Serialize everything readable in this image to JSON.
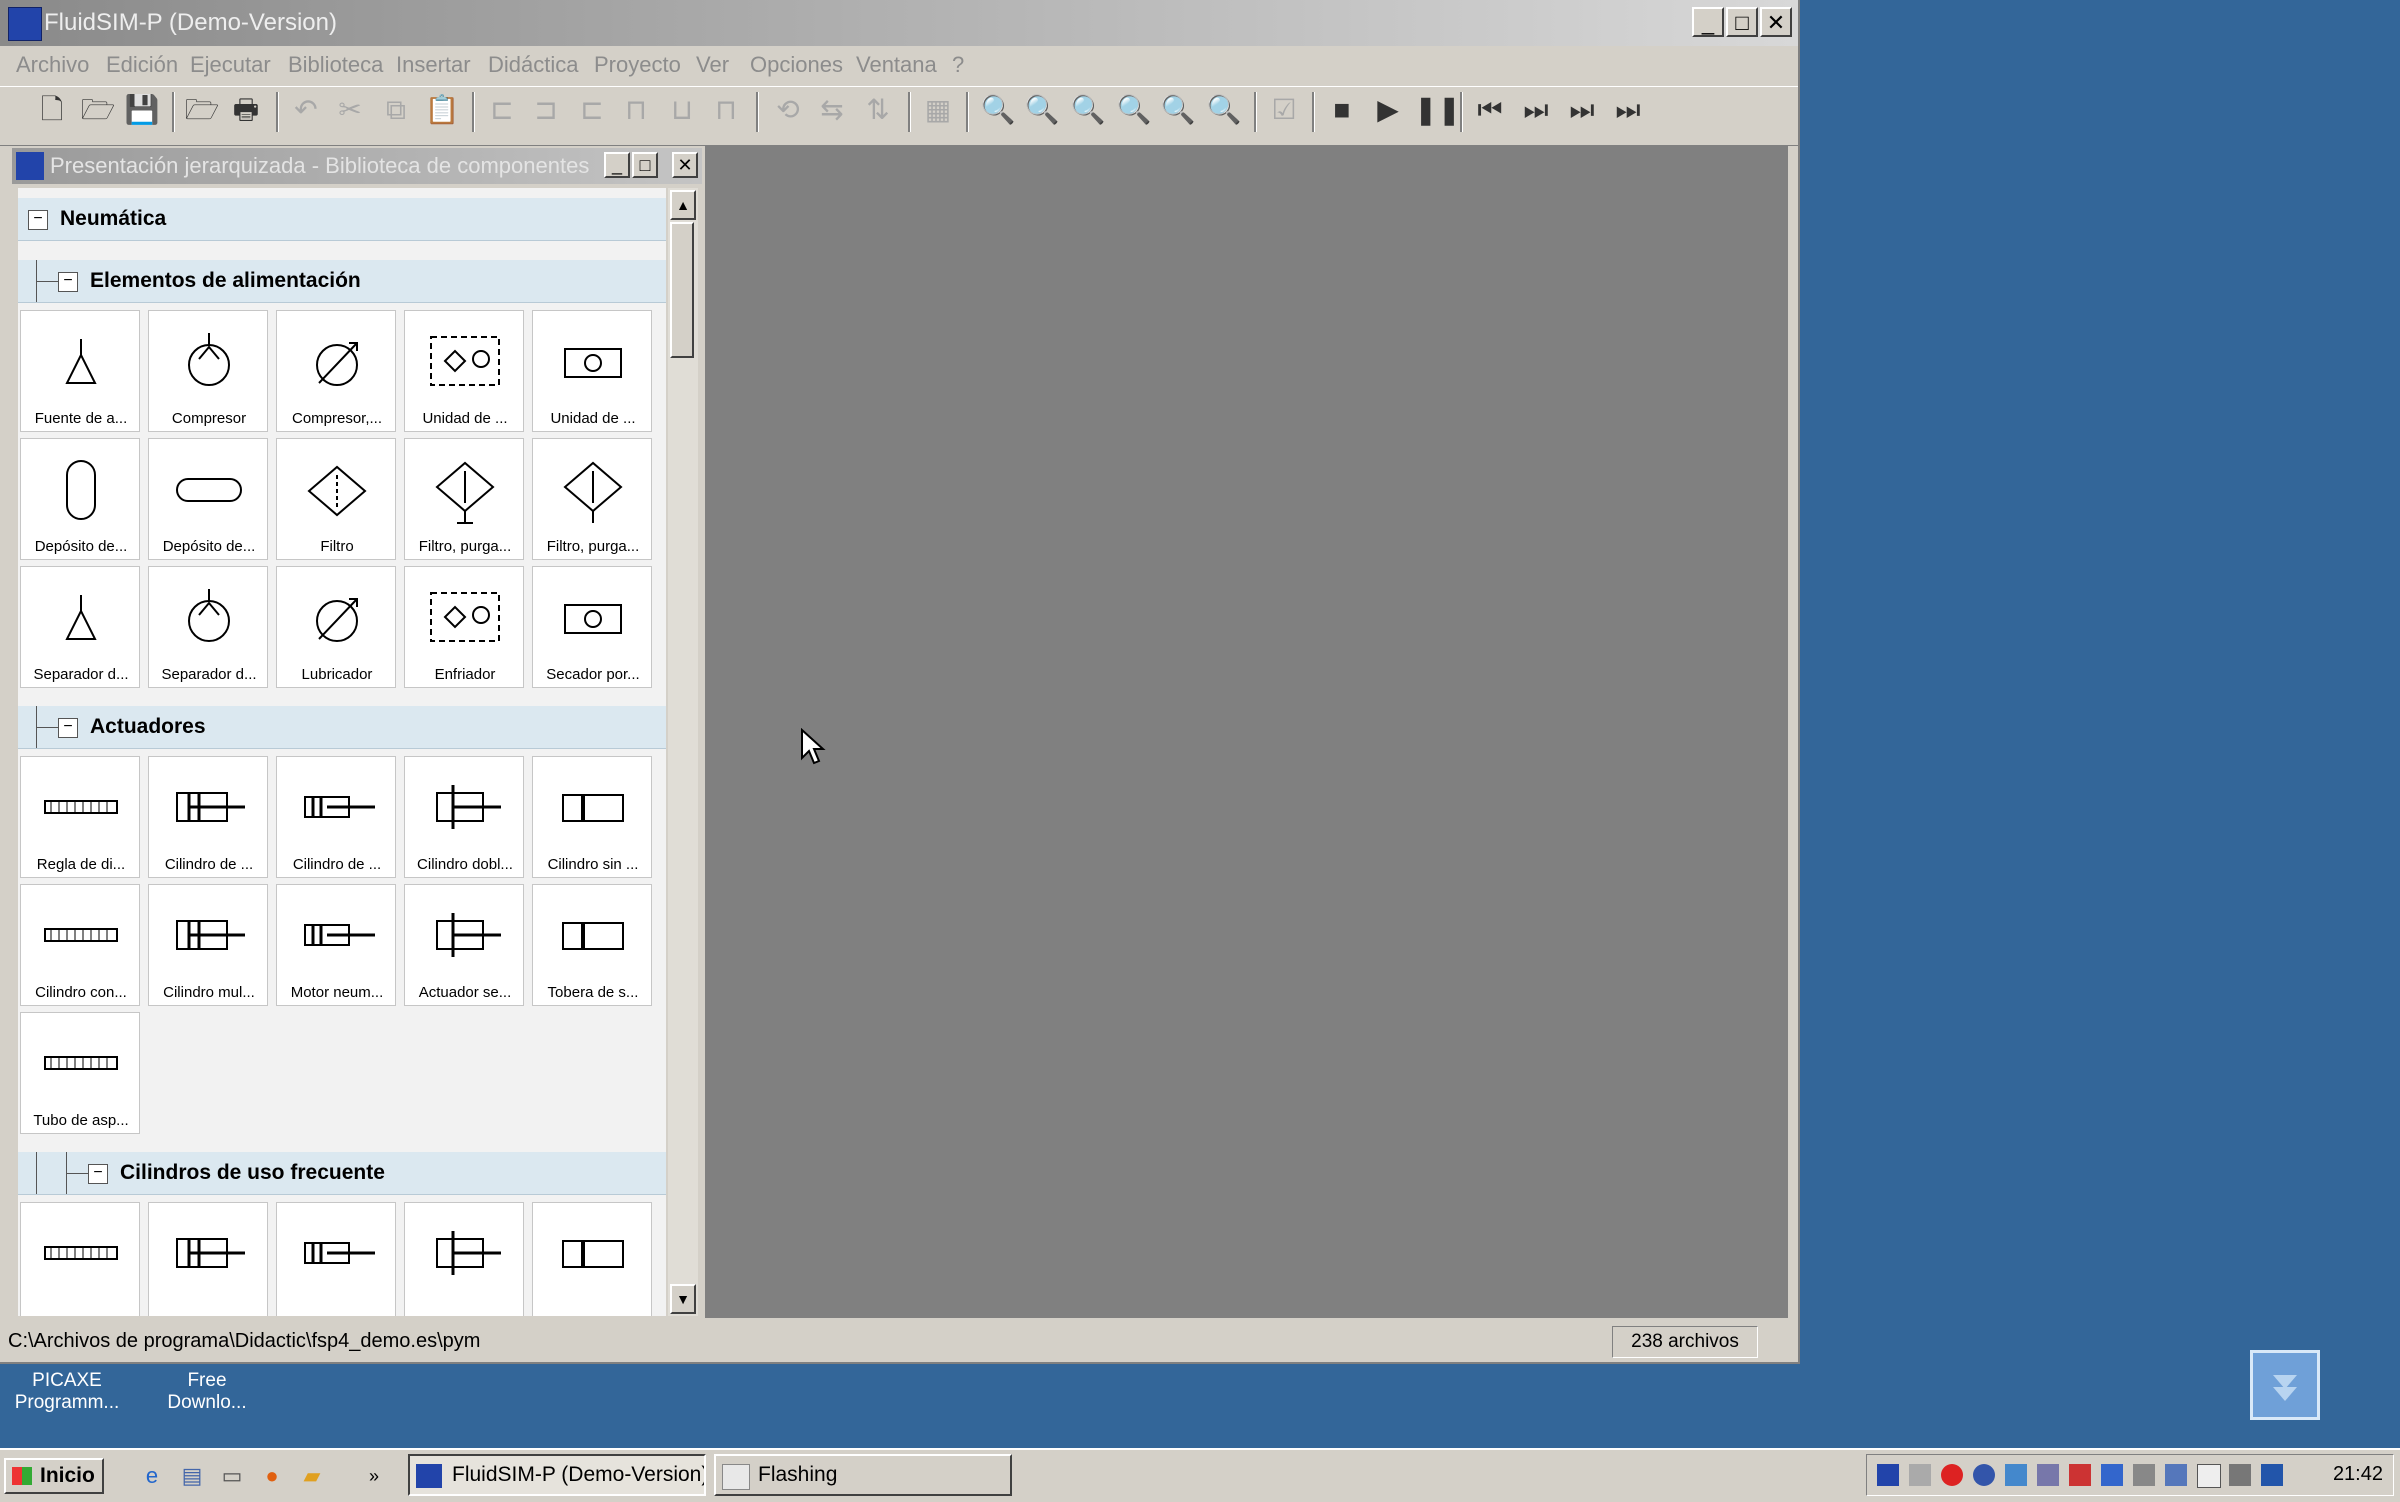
{
  "window": {
    "title": "FluidSIM-P (Demo-Version)",
    "controls": {
      "minimize": "_",
      "maximize": "□",
      "close": "✕"
    }
  },
  "menu": [
    "Archivo",
    "Edición",
    "Ejecutar",
    "Biblioteca",
    "Insertar",
    "Didáctica",
    "Proyecto",
    "Ver",
    "Opciones",
    "Ventana",
    "?"
  ],
  "child_window": {
    "title": "Presentación jerarquizada - Biblioteca de componentes",
    "controls": {
      "minimize": "_",
      "maximize": "□",
      "close": "✕"
    }
  },
  "library": {
    "root": "Neumática",
    "groups": [
      {
        "label": "Elementos de alimentación",
        "items": [
          "Fuente de a...",
          "Compresor",
          "Compresor,...",
          "Unidad de ...",
          "Unidad de ...",
          "Depósito de...",
          "Depósito de...",
          "Filtro",
          "Filtro, purga...",
          "Filtro, purga...",
          "Separador d...",
          "Separador d...",
          "Lubricador",
          "Enfriador",
          "Secador por..."
        ]
      },
      {
        "label": "Actuadores",
        "items": [
          "Regla de di...",
          "Cilindro de ...",
          "Cilindro de ...",
          "Cilindro dobl...",
          "Cilindro sin ...",
          "Cilindro con...",
          "Cilindro mul...",
          "Motor neum...",
          "Actuador se...",
          "Tobera de s...",
          "Tubo de asp..."
        ]
      },
      {
        "label": "Cilindros de uso frecuente",
        "items": [
          "",
          "",
          "",
          "",
          ""
        ]
      }
    ]
  },
  "statusbar": {
    "path": "C:\\Archivos de programa\\Didactic\\fsp4_demo.es\\pym",
    "count": "238 archivos"
  },
  "desktop_icons": [
    {
      "label_line1": "PICAXE",
      "label_line2": "Programm..."
    },
    {
      "label_line1": "Free",
      "label_line2": "Downlo..."
    }
  ],
  "taskbar": {
    "start": "Inicio",
    "tasks": [
      {
        "label": "FluidSIM-P (Demo-Version)"
      },
      {
        "label": "Flashing"
      }
    ],
    "more": "»",
    "clock": "21:42"
  },
  "colors": {
    "desktop": "#336699",
    "workspace": "#808080",
    "category_bg": "#dbe8f0"
  }
}
